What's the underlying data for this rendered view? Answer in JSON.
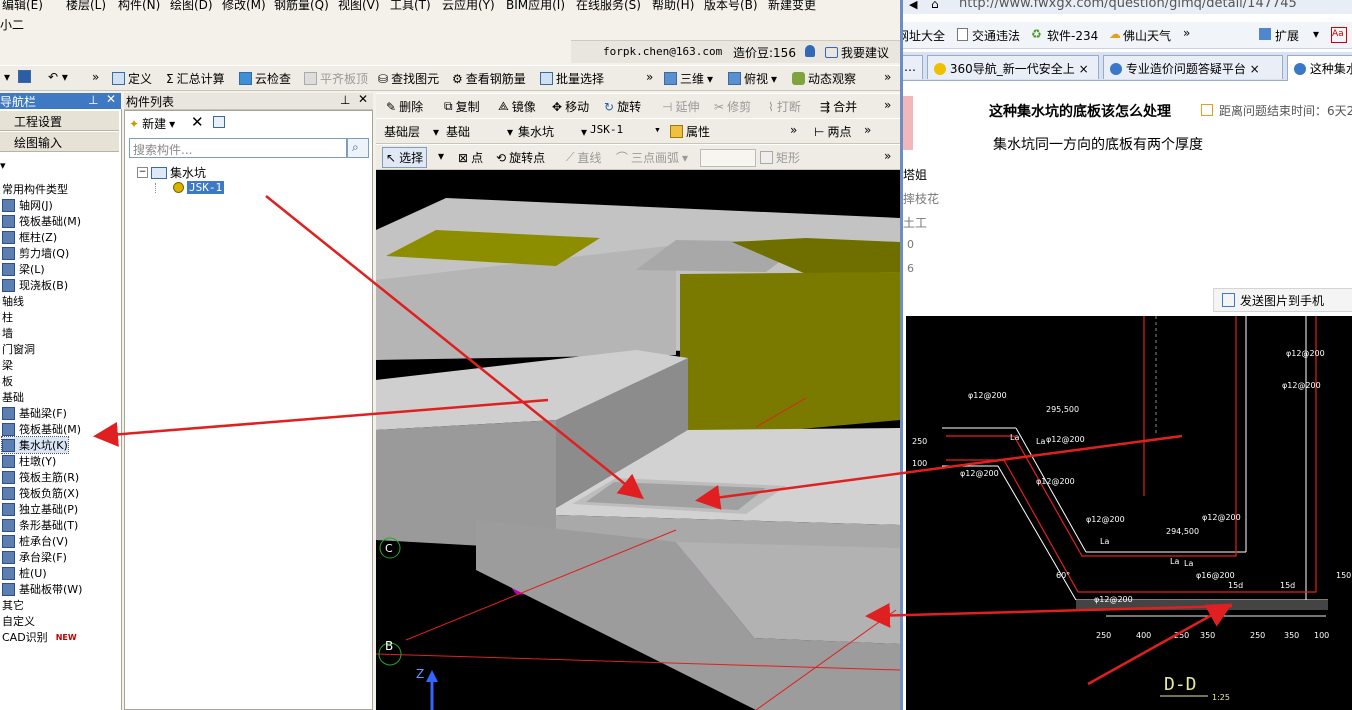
{
  "menu": [
    "编辑(E)",
    "楼层(L)",
    "构件(N)",
    "绘图(D)",
    "修改(M)",
    "钢筋量(Q)",
    "视图(V)",
    "工具(T)",
    "云应用(Y)",
    "BIM应用(I)",
    "在线服务(S)",
    "帮助(H)",
    "版本号(B)",
    "新建变更"
  ],
  "subtitle": "小二",
  "user": {
    "email": "forpk.chen@163.com",
    "beans": "造价豆:156",
    "suggest": "我要建议"
  },
  "toolbar1": {
    "define": "定义",
    "sum": "汇总计算",
    "cloud_check": "云检查",
    "flat": "平齐板顶",
    "find": "查找图元",
    "view_rebar": "查看钢筋量",
    "batch": "批量选择",
    "three_d": "三维",
    "top_view": "俯视",
    "dynamic": "动态观察"
  },
  "nav": {
    "title": "导航栏",
    "btn1": "工程设置",
    "btn2": "绘图输入"
  },
  "nav_items": [
    {
      "label": "常用构件类型",
      "icon": false
    },
    {
      "label": "轴网(J)",
      "icon": true
    },
    {
      "label": "筏板基础(M)",
      "icon": true
    },
    {
      "label": "框柱(Z)",
      "icon": true
    },
    {
      "label": "剪力墙(Q)",
      "icon": true
    },
    {
      "label": "梁(L)",
      "icon": true
    },
    {
      "label": "现浇板(B)",
      "icon": true
    },
    {
      "label": "轴线",
      "icon": false
    },
    {
      "label": "柱",
      "icon": false
    },
    {
      "label": "墙",
      "icon": false
    },
    {
      "label": "门窗洞",
      "icon": false
    },
    {
      "label": "梁",
      "icon": false
    },
    {
      "label": "板",
      "icon": false
    },
    {
      "label": "基础",
      "icon": false
    },
    {
      "label": "基础梁(F)",
      "icon": true
    },
    {
      "label": "筏板基础(M)",
      "icon": true
    },
    {
      "label": "集水坑(K)",
      "icon": true
    },
    {
      "label": "柱墩(Y)",
      "icon": true
    },
    {
      "label": "筏板主筋(R)",
      "icon": true
    },
    {
      "label": "筏板负筋(X)",
      "icon": true
    },
    {
      "label": "独立基础(P)",
      "icon": true
    },
    {
      "label": "条形基础(T)",
      "icon": true
    },
    {
      "label": "桩承台(V)",
      "icon": true
    },
    {
      "label": "承台梁(F)",
      "icon": true
    },
    {
      "label": "桩(U)",
      "icon": true
    },
    {
      "label": "基础板带(W)",
      "icon": true
    },
    {
      "label": "其它",
      "icon": false
    },
    {
      "label": "自定义",
      "icon": false
    },
    {
      "label": "CAD识别",
      "icon": false
    }
  ],
  "new_badge": "NEW",
  "list": {
    "title": "构件列表",
    "new": "新建",
    "search_placeholder": "搜索构件...",
    "root": "集水坑",
    "child": "JSK-1"
  },
  "edit_toolbar": {
    "delete": "删除",
    "copy": "复制",
    "mirror": "镜像",
    "move": "移动",
    "rotate": "旋转",
    "extend": "延伸",
    "trim": "修剪",
    "break": "打断",
    "merge": "合并"
  },
  "props_bar": {
    "floor": "基础层",
    "type": "基础",
    "comp": "集水坑",
    "name": "JSK-1",
    "props": "属性",
    "two_points": "两点"
  },
  "draw_bar": {
    "select": "选择",
    "point": "点",
    "rotate_point": "旋转点",
    "line": "直线",
    "arc": "三点画弧",
    "rect": "矩形"
  },
  "axis": {
    "z": "Z",
    "b": "B",
    "c": "C"
  },
  "browser": {
    "url": "http://www.fwxgx.com/question/glmq/detail/147745",
    "bookmarks": [
      "网址大全",
      "交通违法",
      "软件-234",
      "佛山天气",
      "扩展"
    ],
    "tabs": [
      "360导航_新一代安全上",
      "专业造价问题答疑平台",
      "这种集水"
    ],
    "question_title": "这种集水坑的底板该怎么处理",
    "time_left": "距离问题结束时间：6天2",
    "question_body": "集水坑同一方向的底板有两个厚度",
    "side_user": [
      "塔姐",
      "摔枝花",
      "土工",
      "0",
      "6"
    ],
    "send_photo": "发送图片到手机"
  },
  "cad": {
    "labels": [
      "φ12@200",
      "φ12@200",
      "φ12@200",
      "φ12@200",
      "φ12@200",
      "φ12@200",
      "φ12@200",
      "φ12@200",
      "φ16@200",
      "φ12@200"
    ],
    "dims": [
      "295,500",
      "294,500",
      "250",
      "400",
      "250",
      "350",
      "250",
      "350",
      "100",
      "15d",
      "15d",
      "La",
      "La",
      "La",
      "La",
      "La",
      "150",
      "60°",
      "250",
      "100"
    ],
    "section": "D-D",
    "scale": "1:25"
  },
  "colors": {
    "navy": "#3f79c4",
    "olive": "#7a7a00",
    "magenta": "#c800c8",
    "arrow": "#e02020"
  }
}
